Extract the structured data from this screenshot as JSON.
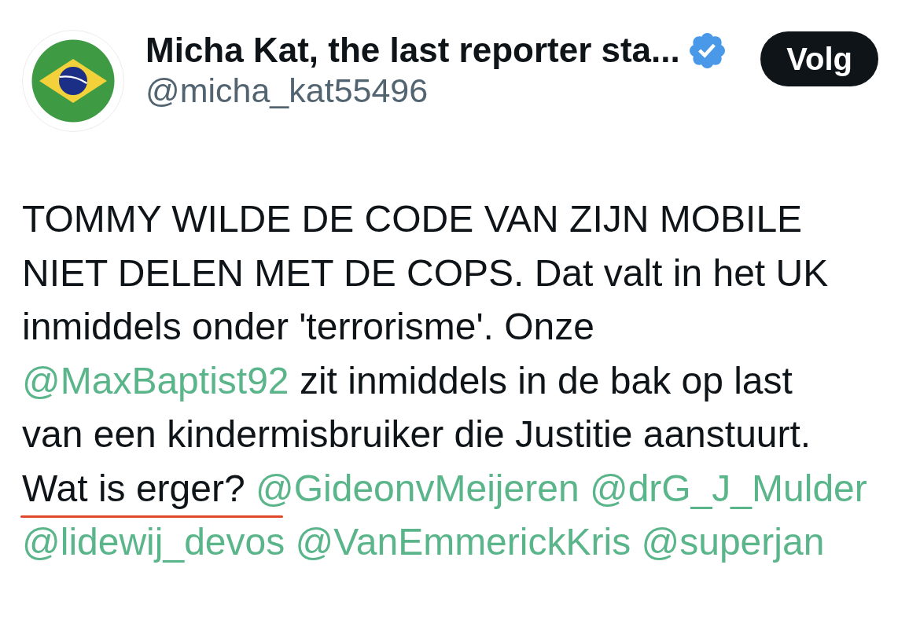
{
  "author": {
    "name": "Micha Kat, the last reporter sta...",
    "handle": "@micha_kat55496",
    "verified": true
  },
  "follow_button": {
    "label": "Volg"
  },
  "tweet": {
    "lines": [
      [
        {
          "kind": "text",
          "text": "TOMMY WILDE DE CODE VAN ZIJN MOBILE",
          "underlined": false
        }
      ],
      [
        {
          "kind": "text",
          "text": "NIET DELEN MET DE COPS. Dat valt in het UK",
          "underlined": false
        }
      ],
      [
        {
          "kind": "text",
          "text": "inmiddels onder 'terrorisme'. Onze",
          "underlined": false
        }
      ],
      [
        {
          "kind": "mention",
          "text": "@MaxBaptist92",
          "underlined": false
        },
        {
          "kind": "text",
          "text": "zit inmiddels in de bak op last",
          "underlined": false
        }
      ],
      [
        {
          "kind": "text",
          "text": "van een kindermisbruiker die Justitie aanstuurt.",
          "underlined": false
        }
      ],
      [
        {
          "kind": "text",
          "text": "Wat is erger?",
          "underlined": true
        },
        {
          "kind": "mention",
          "text": "@GideonvMeijeren",
          "underlined": false
        },
        {
          "kind": "mention",
          "text": "@drG_J_Mulder",
          "underlined": false
        }
      ],
      [
        {
          "kind": "mention",
          "text": "@lidewij_devos",
          "underlined": false
        },
        {
          "kind": "mention",
          "text": "@VanEmmerickKris",
          "underlined": false
        },
        {
          "kind": "mention",
          "text": "@superjan",
          "underlined": false
        }
      ]
    ]
  }
}
